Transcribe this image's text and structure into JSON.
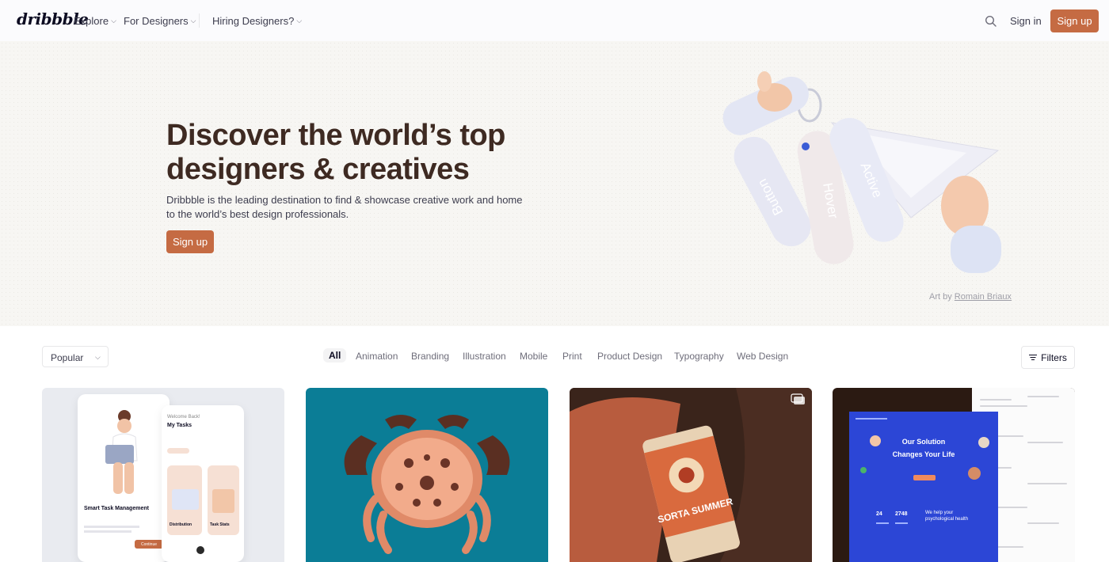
{
  "nav": {
    "logo": "dribbble",
    "explore": "Explore",
    "for_designers": "For Designers",
    "hiring": "Hiring Designers?",
    "sign_in": "Sign in",
    "sign_up": "Sign up"
  },
  "hero": {
    "title": "Discover the world’s top designers & creatives",
    "subtitle": "Dribbble is the leading destination to find & showcase creative work and home to the world’s best design professionals.",
    "cta": "Sign up",
    "art_credit_prefix": "Art by ",
    "art_credit_author": "Romain Briaux",
    "art_labels": [
      "Button",
      "Hover",
      "Active"
    ]
  },
  "filters": {
    "sort_value": "Popular",
    "categories": [
      "All",
      "Animation",
      "Branding",
      "Illustration",
      "Mobile",
      "Print",
      "Product Design",
      "Typography",
      "Web Design"
    ],
    "active_category": "All",
    "filters_label": "Filters"
  },
  "shots": [
    {
      "phone_left": {
        "title": "Smart Task Management",
        "button": "Continue"
      },
      "phone_right": {
        "greeting": "Welcome Back!",
        "heading": "My Tasks",
        "card1": "Distribution",
        "card2": "Task Stats"
      }
    },
    {},
    {
      "can_text": "SORTA SUMMER"
    },
    {
      "card_title_1": "Our Solution",
      "card_title_2": "Changes Your Life",
      "stat_1": "24",
      "stat_2": "2748",
      "tagline": "We help your psychological health"
    }
  ],
  "colors": {
    "brand": "#c56b43",
    "hero_title": "#3e2a22",
    "crab_bg": "#0b7d96",
    "blue_card": "#2c46d6"
  }
}
